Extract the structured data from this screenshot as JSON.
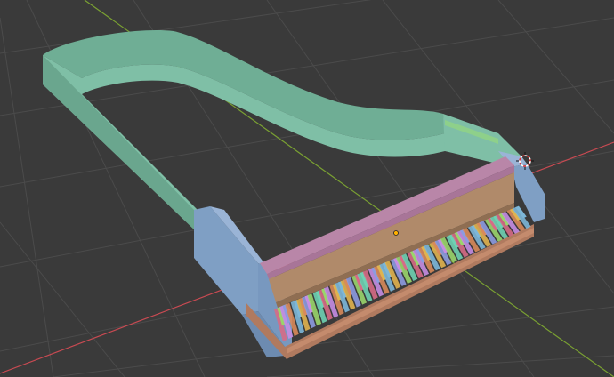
{
  "app": {
    "name": "3D viewport",
    "view": "perspective"
  },
  "viewport": {
    "background_color": "#3a3a3a",
    "grid_color": "#4a4a4a",
    "x_axis_color": "#c94a52",
    "y_axis_color": "#7aa132"
  },
  "model": {
    "type": "piano-keyboard-frame",
    "rim_color": "#7fbfa6",
    "cheek_color": "#7f9fc4",
    "fallboard_color": "#b08a6a",
    "nameboard_color": "#b986a8",
    "base_color": "#b07a5f",
    "key_palette": [
      "#d66b86",
      "#7db7d8",
      "#9ad56b",
      "#c58de3",
      "#e0b34f",
      "#6fd1b3",
      "#d88a5a",
      "#8d9be0"
    ]
  },
  "gizmos": {
    "cursor_3d": "3d-cursor-icon",
    "origin": "object-origin-dot"
  }
}
